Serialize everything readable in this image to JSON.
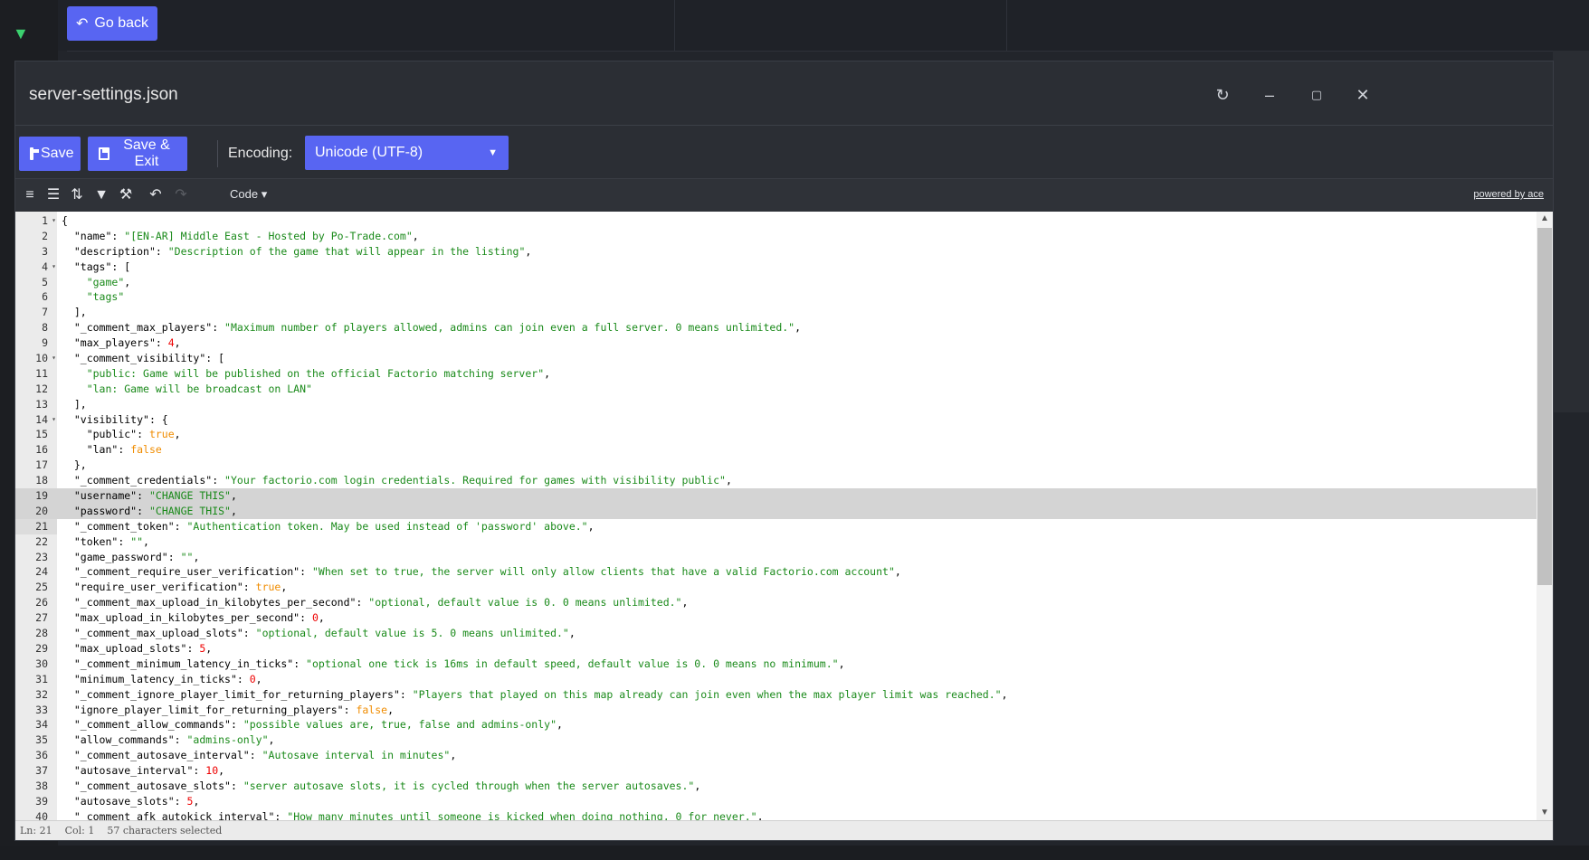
{
  "page": {
    "go_back": "Go back"
  },
  "dialog": {
    "title": "server-settings.json",
    "header_icons": [
      "refresh-icon",
      "minimize-icon",
      "maximize-icon",
      "close-icon"
    ]
  },
  "toolbar": {
    "save_label": "Save",
    "save_exit_label": "Save & Exit",
    "encoding_label": "Encoding:",
    "encoding_value": "Unicode (UTF-8)"
  },
  "ace_menu": {
    "icons": [
      "format-icon",
      "compact-icon",
      "sort-icon",
      "filter-icon",
      "wrench-icon",
      "undo-icon",
      "redo-icon"
    ],
    "mode": "Code",
    "powered_by": "powered by ace"
  },
  "editor": {
    "active_line": 21,
    "selected_lines": [
      19,
      20
    ],
    "lines": [
      {
        "n": 1,
        "fold": true,
        "t": "{"
      },
      {
        "n": 2,
        "t": "  \"name\": \"[EN-AR] Middle East - Hosted by Po-Trade.com\","
      },
      {
        "n": 3,
        "t": "  \"description\": \"Description of the game that will appear in the listing\","
      },
      {
        "n": 4,
        "fold": true,
        "t": "  \"tags\": ["
      },
      {
        "n": 5,
        "t": "    \"game\","
      },
      {
        "n": 6,
        "t": "    \"tags\""
      },
      {
        "n": 7,
        "t": "  ],"
      },
      {
        "n": 8,
        "t": "  \"_comment_max_players\": \"Maximum number of players allowed, admins can join even a full server. 0 means unlimited.\","
      },
      {
        "n": 9,
        "t": "  \"max_players\": 4,"
      },
      {
        "n": 10,
        "fold": true,
        "t": "  \"_comment_visibility\": ["
      },
      {
        "n": 11,
        "t": "    \"public: Game will be published on the official Factorio matching server\","
      },
      {
        "n": 12,
        "t": "    \"lan: Game will be broadcast on LAN\""
      },
      {
        "n": 13,
        "t": "  ],"
      },
      {
        "n": 14,
        "fold": true,
        "t": "  \"visibility\": {"
      },
      {
        "n": 15,
        "t": "    \"public\": true,"
      },
      {
        "n": 16,
        "t": "    \"lan\": false"
      },
      {
        "n": 17,
        "t": "  },"
      },
      {
        "n": 18,
        "t": "  \"_comment_credentials\": \"Your factorio.com login credentials. Required for games with visibility public\","
      },
      {
        "n": 19,
        "t": "  \"username\": \"CHANGE THIS\","
      },
      {
        "n": 20,
        "t": "  \"password\": \"CHANGE THIS\","
      },
      {
        "n": 21,
        "t": "  \"_comment_token\": \"Authentication token. May be used instead of 'password' above.\","
      },
      {
        "n": 22,
        "t": "  \"token\": \"\","
      },
      {
        "n": 23,
        "t": "  \"game_password\": \"\","
      },
      {
        "n": 24,
        "t": "  \"_comment_require_user_verification\": \"When set to true, the server will only allow clients that have a valid Factorio.com account\","
      },
      {
        "n": 25,
        "t": "  \"require_user_verification\": true,"
      },
      {
        "n": 26,
        "t": "  \"_comment_max_upload_in_kilobytes_per_second\": \"optional, default value is 0. 0 means unlimited.\","
      },
      {
        "n": 27,
        "t": "  \"max_upload_in_kilobytes_per_second\": 0,"
      },
      {
        "n": 28,
        "t": "  \"_comment_max_upload_slots\": \"optional, default value is 5. 0 means unlimited.\","
      },
      {
        "n": 29,
        "t": "  \"max_upload_slots\": 5,"
      },
      {
        "n": 30,
        "t": "  \"_comment_minimum_latency_in_ticks\": \"optional one tick is 16ms in default speed, default value is 0. 0 means no minimum.\","
      },
      {
        "n": 31,
        "t": "  \"minimum_latency_in_ticks\": 0,"
      },
      {
        "n": 32,
        "t": "  \"_comment_ignore_player_limit_for_returning_players\": \"Players that played on this map already can join even when the max player limit was reached.\","
      },
      {
        "n": 33,
        "t": "  \"ignore_player_limit_for_returning_players\": false,"
      },
      {
        "n": 34,
        "t": "  \"_comment_allow_commands\": \"possible values are, true, false and admins-only\","
      },
      {
        "n": 35,
        "t": "  \"allow_commands\": \"admins-only\","
      },
      {
        "n": 36,
        "t": "  \"_comment_autosave_interval\": \"Autosave interval in minutes\","
      },
      {
        "n": 37,
        "t": "  \"autosave_interval\": 10,"
      },
      {
        "n": 38,
        "t": "  \"_comment_autosave_slots\": \"server autosave slots, it is cycled through when the server autosaves.\","
      },
      {
        "n": 39,
        "t": "  \"autosave_slots\": 5,"
      },
      {
        "n": 40,
        "t": "  \"_comment_afk_autokick_interval\": \"How many minutes until someone is kicked when doing nothing, 0 for never.\","
      }
    ]
  },
  "status": {
    "ln": "Ln: 21",
    "col": "Col: 1",
    "selection": "57 characters selected"
  },
  "colors": {
    "accent": "#5865f2",
    "string": "#1a8a1a",
    "number": "#e00000",
    "boolean": "#f08c00"
  }
}
